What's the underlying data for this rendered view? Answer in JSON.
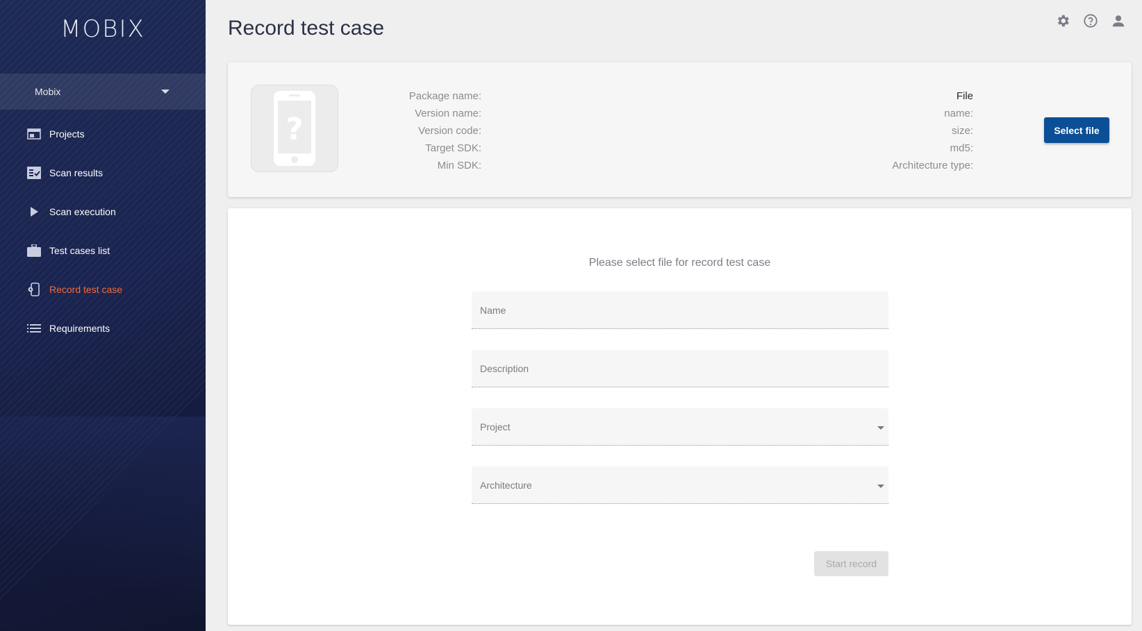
{
  "sidebar": {
    "logo": "MOBIX",
    "workspace": "Mobix",
    "items": [
      {
        "label": "Projects",
        "icon": "projects-icon"
      },
      {
        "label": "Scan results",
        "icon": "scan-results-icon"
      },
      {
        "label": "Scan execution",
        "icon": "play-icon"
      },
      {
        "label": "Test cases list",
        "icon": "briefcase-icon"
      },
      {
        "label": "Record test case",
        "icon": "record-device-icon",
        "active": true
      },
      {
        "label": "Requirements",
        "icon": "list-icon"
      }
    ],
    "active_color": "#f26a3b"
  },
  "header": {
    "title": "Record test case",
    "icons": [
      "gear-icon",
      "help-icon",
      "user-icon"
    ]
  },
  "file_info": {
    "left_labels": [
      "Package name:",
      "Version name:",
      "Version code:",
      "Target SDK:",
      "Min SDK:"
    ],
    "right_heading": "File",
    "right_labels": [
      "name:",
      "size:",
      "md5:",
      "Architecture type:"
    ],
    "select_button": "Select file",
    "button_color": "#0c4f96"
  },
  "form": {
    "hint": "Please select file for record test case",
    "name_placeholder": "Name",
    "description_placeholder": "Description",
    "project_label": "Project",
    "architecture_label": "Architecture",
    "start_button": "Start record"
  }
}
